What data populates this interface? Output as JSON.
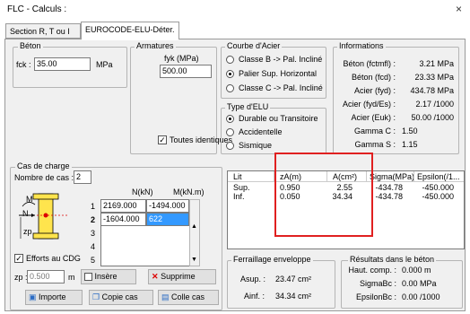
{
  "window": {
    "title": "FLC - Calculs :",
    "close_glyph": "×"
  },
  "tabs": [
    {
      "label": "Section R, T ou I",
      "active": false
    },
    {
      "label": "EUROCODE-ELU-Déter.",
      "active": true
    }
  ],
  "beton": {
    "title": "Béton",
    "fck_label": "fck :",
    "fck_value": "35.00",
    "unit": "MPa"
  },
  "armatures": {
    "title": "Armatures",
    "fyk_label": "fyk (MPa)",
    "fyk_value": "500.00",
    "identical_label": "Toutes identiques",
    "identical_checked": true
  },
  "courbe_acier": {
    "title": "Courbe d'Acier",
    "options": [
      {
        "label": "Classe B -> Pal. Incliné",
        "selected": false
      },
      {
        "label": "Palier Sup. Horizontal",
        "selected": true
      },
      {
        "label": "Classe C -> Pal. Incliné",
        "selected": false
      }
    ]
  },
  "type_elu": {
    "title": "Type d'ELU",
    "options": [
      {
        "label": "Durable ou Transitoire",
        "selected": true
      },
      {
        "label": "Accidentelle",
        "selected": false
      },
      {
        "label": "Sismique",
        "selected": false
      }
    ]
  },
  "informations": {
    "title": "Informations",
    "rows": [
      {
        "label": "Béton (fctmfl) :",
        "value": "3.21 MPa"
      },
      {
        "label": "Béton (fcd) :",
        "value": "23.33 MPa"
      },
      {
        "label": "Acier (fyd) :",
        "value": "434.78 MPa"
      },
      {
        "label": "Acier (fyd/Es) :",
        "value": "2.17 /1000"
      },
      {
        "label": "Acier (Euk) :",
        "value": "50.00 /1000"
      },
      {
        "label": "Gamma C :",
        "value": "1.50"
      },
      {
        "label": "Gamma S :",
        "value": "1.15"
      }
    ]
  },
  "cas_charge": {
    "title": "Cas de charge",
    "count_label": "Nombre de cas :",
    "count_value": "2",
    "col_n": "N(kN)",
    "col_m": "M(kN.m)",
    "diagram_labels": {
      "m": "M",
      "n": "N",
      "zp": "zp"
    },
    "rows": [
      {
        "num": "1",
        "n": "2169.000",
        "m": "-1494.000"
      },
      {
        "num": "2",
        "n": "-1604.000",
        "m": "622"
      },
      {
        "num": "3",
        "n": "",
        "m": ""
      },
      {
        "num": "4",
        "n": "",
        "m": ""
      },
      {
        "num": "5",
        "n": "",
        "m": ""
      }
    ],
    "efforts_label": "Efforts au CDG",
    "efforts_checked": true,
    "zp_label": "zp :",
    "zp_value": "0.500",
    "zp_unit": "m",
    "insere_label": "Insère",
    "supprime_label": "Supprime",
    "importe_label": "Importe",
    "copie_label": "Copie cas",
    "colle_label": "Colle cas"
  },
  "results_table": {
    "headers": [
      "Lit",
      "zA(m)",
      "A(cm²)",
      "Sigma(MPa)",
      "Epsilon(/1..."
    ],
    "rows": [
      [
        "Sup.",
        "0.950",
        "2.55",
        "-434.78",
        "-450.000"
      ],
      [
        "Inf.",
        "0.050",
        "34.34",
        "-434.78",
        "-450.000"
      ]
    ],
    "highlight_color": "#e02020"
  },
  "ferraillage": {
    "title": "Ferraillage enveloppe",
    "asup_label": "Asup. :",
    "asup_value": "23.47 cm²",
    "ainf_label": "Ainf. :",
    "ainf_value": "34.34 cm²"
  },
  "resultats_beton": {
    "title": "Résultats dans le béton",
    "rows": [
      {
        "label": "Haut. comp. :",
        "value": "0.000 m"
      },
      {
        "label": "SigmaBc :",
        "value": "0.00 MPa"
      },
      {
        "label": "EpsilonBc :",
        "value": "0.00 /1000"
      }
    ]
  }
}
